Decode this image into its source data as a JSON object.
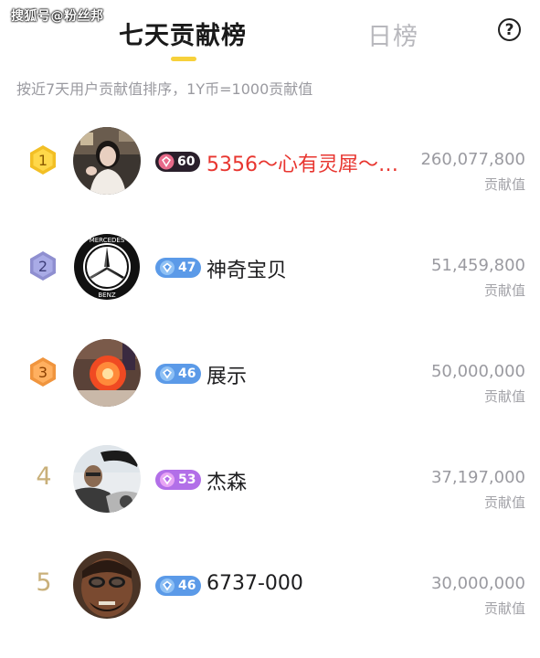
{
  "watermark": "搜狐号@粉丝邦",
  "tabs": {
    "active": "七天贡献榜",
    "inactive": "日榜",
    "help_glyph": "?"
  },
  "subtitle": "按近7天用户贡献值排序，1Y币=1000贡献值",
  "colors": {
    "gold": "#f2bf25",
    "silver": "#8f8fd0",
    "bronze": "#f0953e",
    "top_name": "#e8352f",
    "tab_underline": "#f7d13b"
  },
  "rows": [
    {
      "rank": "1",
      "level": "60",
      "level_style": "dark",
      "name": "5356～心有灵犀～…",
      "score": "260,077,800",
      "unit": "贡献值"
    },
    {
      "rank": "2",
      "level": "47",
      "level_style": "blue",
      "name": "神奇宝贝",
      "score": "51,459,800",
      "unit": "贡献值"
    },
    {
      "rank": "3",
      "level": "46",
      "level_style": "blue",
      "name": "展示",
      "score": "50,000,000",
      "unit": "贡献值"
    },
    {
      "rank": "4",
      "level": "53",
      "level_style": "purple",
      "name": "杰森",
      "score": "37,197,000",
      "unit": "贡献值"
    },
    {
      "rank": "5",
      "level": "46",
      "level_style": "blue",
      "name": "6737-000",
      "score": "30,000,000",
      "unit": "贡献值"
    }
  ],
  "mercedes_text": {
    "top": "MERCEDES",
    "bottom": "BENZ"
  }
}
